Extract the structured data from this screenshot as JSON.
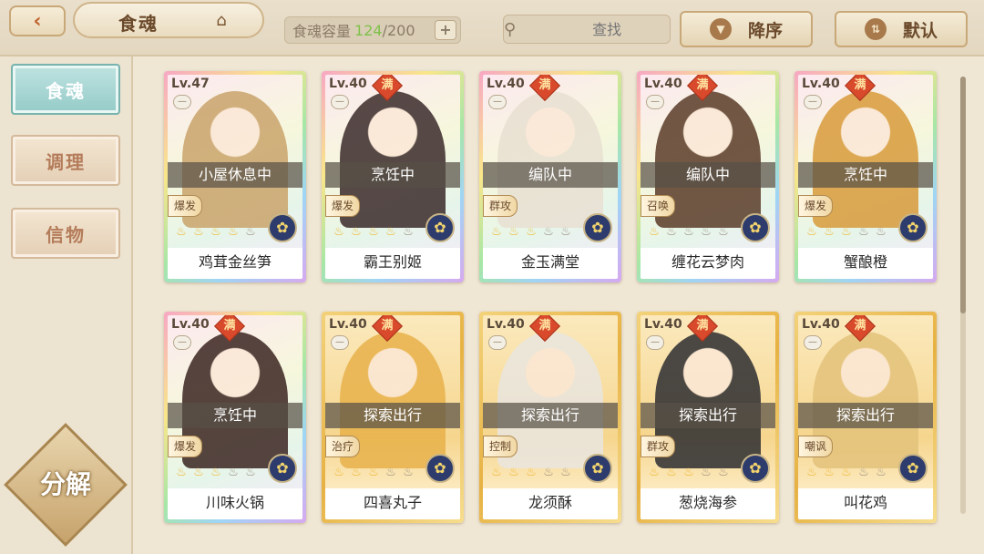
{
  "header": {
    "back_icon": "back-arrow-icon",
    "title": "食魂",
    "title_icon": "house-icon",
    "capacity_label": "食魂容量",
    "capacity_current": "124",
    "capacity_max": "/200",
    "add_symbol": "+",
    "search_placeholder": "查找",
    "search_clear_symbol": "✕",
    "sort_order_label": "降序",
    "sort_mode_label": "默认"
  },
  "sidebar": {
    "items": [
      {
        "label": "食魂"
      },
      {
        "label": "调理"
      },
      {
        "label": "信物"
      }
    ],
    "decompose_label": "分解"
  },
  "cards": [
    {
      "level": "Lv.47",
      "full": false,
      "status": "小屋休息中",
      "role": "爆发",
      "stars_on": 4,
      "name": "鸡茸金丝笋",
      "frame": "rainbow",
      "portrait_color": "#c9a36a"
    },
    {
      "level": "Lv.40",
      "full": true,
      "status": "烹饪中",
      "role": "爆发",
      "stars_on": 4,
      "name": "霸王别姬",
      "frame": "rainbow",
      "portrait_color": "#3a2a2a"
    },
    {
      "level": "Lv.40",
      "full": true,
      "status": "编队中",
      "role": "群攻",
      "stars_on": 3,
      "name": "金玉满堂",
      "frame": "rainbow",
      "portrait_color": "#e8e0d2"
    },
    {
      "level": "Lv.40",
      "full": true,
      "status": "编队中",
      "role": "召唤",
      "stars_on": 1,
      "name": "缠花云梦肉",
      "frame": "rainbow",
      "portrait_color": "#5a3b28"
    },
    {
      "level": "Lv.40",
      "full": true,
      "status": "烹饪中",
      "role": "爆发",
      "stars_on": 3,
      "name": "蟹酿橙",
      "frame": "rainbow",
      "portrait_color": "#d89a3a"
    },
    {
      "level": "Lv.40",
      "full": true,
      "status": "烹饪中",
      "role": "爆发",
      "stars_on": 3,
      "name": "川味火锅",
      "frame": "rainbow",
      "portrait_color": "#3a2420"
    },
    {
      "level": "Lv.40",
      "full": true,
      "status": "探索出行",
      "role": "治疗",
      "stars_on": 3,
      "name": "四喜丸子",
      "frame": "gold",
      "portrait_color": "#e8b14a"
    },
    {
      "level": "Lv.40",
      "full": true,
      "status": "探索出行",
      "role": "控制",
      "stars_on": 3,
      "name": "龙须酥",
      "frame": "gold",
      "portrait_color": "#e9e6e0"
    },
    {
      "level": "Lv.40",
      "full": true,
      "status": "探索出行",
      "role": "群攻",
      "stars_on": 3,
      "name": "葱烧海参",
      "frame": "gold",
      "portrait_color": "#2c2c30"
    },
    {
      "level": "Lv.40",
      "full": true,
      "status": "探索出行",
      "role": "嘲讽",
      "stars_on": 3,
      "name": "叫花鸡",
      "frame": "gold",
      "portrait_color": "#e3c27a"
    }
  ],
  "full_badge_text": "满",
  "star_glyph": "♨",
  "element_glyph": "✿",
  "lock_glyph": "—"
}
